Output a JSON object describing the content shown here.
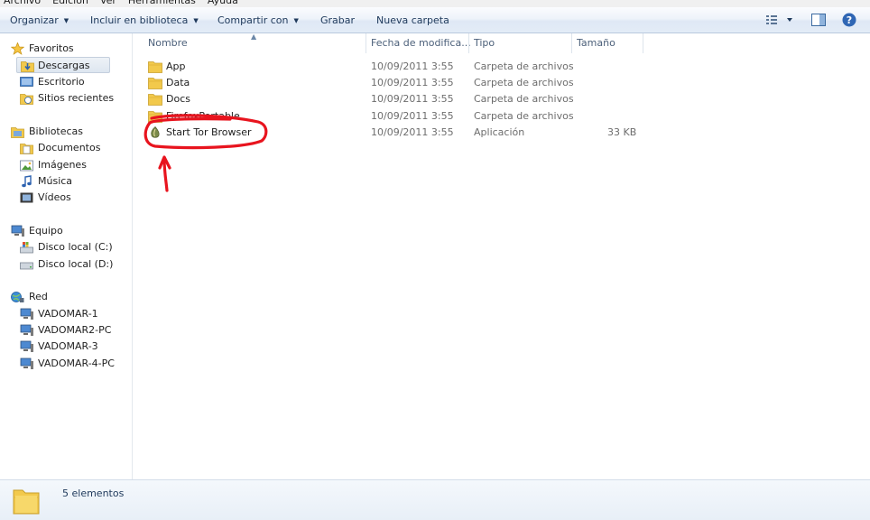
{
  "menubar": {
    "items": [
      "Archivo",
      "Edición",
      "Ver",
      "Herramientas",
      "Ayuda"
    ]
  },
  "toolbar": {
    "organize": "Organizar",
    "include_library": "Incluir en biblioteca",
    "share_with": "Compartir con",
    "burn": "Grabar",
    "new_folder": "Nueva carpeta"
  },
  "nav": {
    "favorites": "Favoritos",
    "downloads": "Descargas",
    "desktop": "Escritorio",
    "recent": "Sitios recientes",
    "libraries": "Bibliotecas",
    "documents": "Documentos",
    "images": "Imágenes",
    "music": "Música",
    "videos": "Vídeos",
    "computer": "Equipo",
    "disk_c": "Disco local (C:)",
    "disk_d": "Disco local (D:)",
    "network": "Red",
    "pcs": [
      "VADOMAR-1",
      "VADOMAR2-PC",
      "VADOMAR-3",
      "VADOMAR-4-PC"
    ]
  },
  "columns": {
    "name": "Nombre",
    "date": "Fecha de modifica...",
    "type": "Tipo",
    "size": "Tamaño"
  },
  "files": [
    {
      "name": "App",
      "date": "10/09/2011 3:55",
      "type": "Carpeta de archivos",
      "size": ""
    },
    {
      "name": "Data",
      "date": "10/09/2011 3:55",
      "type": "Carpeta de archivos",
      "size": ""
    },
    {
      "name": "Docs",
      "date": "10/09/2011 3:55",
      "type": "Carpeta de archivos",
      "size": ""
    },
    {
      "name": "FirefoxPortable",
      "date": "10/09/2011 3:55",
      "type": "Carpeta de archivos",
      "size": ""
    },
    {
      "name": "Start Tor Browser",
      "date": "10/09/2011 3:55",
      "type": "Aplicación",
      "size": "33 KB"
    }
  ],
  "details": {
    "count": "5 elementos"
  },
  "colors": {
    "annotation": "#e8141e",
    "toolbar_text": "#1e395b",
    "folder": "#f2c94c"
  }
}
